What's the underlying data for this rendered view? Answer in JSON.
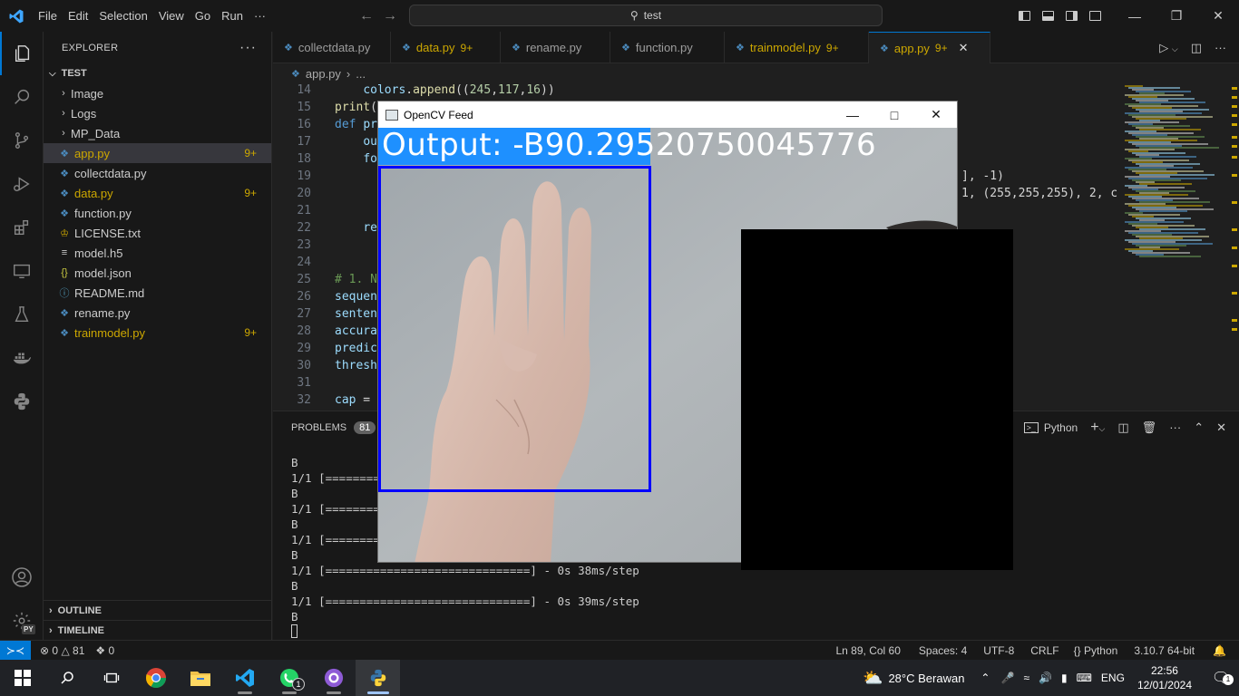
{
  "titlebar": {
    "menu": [
      "File",
      "Edit",
      "Selection",
      "View",
      "Go",
      "Run",
      "···"
    ],
    "search": "test"
  },
  "sidebar": {
    "header": "EXPLORER",
    "root": "TEST",
    "items": [
      {
        "label": "Image",
        "type": "folder"
      },
      {
        "label": "Logs",
        "type": "folder"
      },
      {
        "label": "MP_Data",
        "type": "folder"
      },
      {
        "label": "app.py",
        "type": "py",
        "badge": "9+",
        "modified": true,
        "selected": true
      },
      {
        "label": "collectdata.py",
        "type": "py"
      },
      {
        "label": "data.py",
        "type": "py",
        "badge": "9+",
        "modified": true
      },
      {
        "label": "function.py",
        "type": "py"
      },
      {
        "label": "LICENSE.txt",
        "type": "license"
      },
      {
        "label": "model.h5",
        "type": "text"
      },
      {
        "label": "model.json",
        "type": "json"
      },
      {
        "label": "README.md",
        "type": "info"
      },
      {
        "label": "rename.py",
        "type": "py"
      },
      {
        "label": "trainmodel.py",
        "type": "py",
        "badge": "9+",
        "modified": true
      }
    ],
    "outline": "OUTLINE",
    "timeline": "TIMELINE"
  },
  "tabs": [
    {
      "label": "collectdata.py"
    },
    {
      "label": "data.py",
      "count": "9+",
      "modified": true
    },
    {
      "label": "rename.py"
    },
    {
      "label": "function.py"
    },
    {
      "label": "trainmodel.py",
      "count": "9+",
      "modified": true
    },
    {
      "label": "app.py",
      "count": "9+",
      "modified": true,
      "active": true
    }
  ],
  "breadcrumb": {
    "file": "app.py",
    "rest": "..."
  },
  "code": [
    {
      "n": "14",
      "t": "    colors.append((245,117,16))"
    },
    {
      "n": "15",
      "t": "print("
    },
    {
      "n": "16",
      "t": "def pr"
    },
    {
      "n": "17",
      "t": "    ou"
    },
    {
      "n": "18",
      "t": "    fo"
    },
    {
      "n": "19",
      "t": ""
    },
    {
      "n": "20",
      "t": ""
    },
    {
      "n": "21",
      "t": ""
    },
    {
      "n": "22",
      "t": "    re"
    },
    {
      "n": "23",
      "t": ""
    },
    {
      "n": "24",
      "t": ""
    },
    {
      "n": "25",
      "t": "# 1. N"
    },
    {
      "n": "26",
      "t": "sequen"
    },
    {
      "n": "27",
      "t": "senten"
    },
    {
      "n": "28",
      "t": "accura"
    },
    {
      "n": "29",
      "t": "predic"
    },
    {
      "n": "30",
      "t": "thresh"
    },
    {
      "n": "31",
      "t": ""
    },
    {
      "n": "32",
      "t": "cap = "
    }
  ],
  "code_right": {
    "line19": "], -1)",
    "line20": "1, (255,255,255), 2, c"
  },
  "panel": {
    "problems_label": "PROBLEMS",
    "problems_count": "81",
    "terminal_name": "Python",
    "lines": [
      "B",
      "1/1 [=========",
      "B",
      "1/1 [=========",
      "B",
      "1/1 [=========",
      "B",
      "1/1 [==============================] - 0s 38ms/step",
      "B",
      "1/1 [==============================] - 0s 39ms/step",
      "B"
    ]
  },
  "statusbar": {
    "errors": "0",
    "warnings": "81",
    "ports": "0",
    "position": "Ln 89, Col 60",
    "spaces": "Spaces: 4",
    "encoding": "UTF-8",
    "eol": "CRLF",
    "language": "Python",
    "interpreter": "3.10.7 64-bit"
  },
  "opencv": {
    "title": "OpenCV Feed",
    "output": "Output: -B90.29520750045776"
  },
  "taskbar": {
    "weather": "28°C  Berawan",
    "lang": "ENG",
    "time": "22:56",
    "date": "12/01/2024",
    "whatsapp_badge": "1",
    "notif_badge": "1"
  },
  "colors": {
    "accent": "#0078d4",
    "modified": "#cca700",
    "opencv_banner": "#1e90ff",
    "roi_box": "#0000ff"
  }
}
